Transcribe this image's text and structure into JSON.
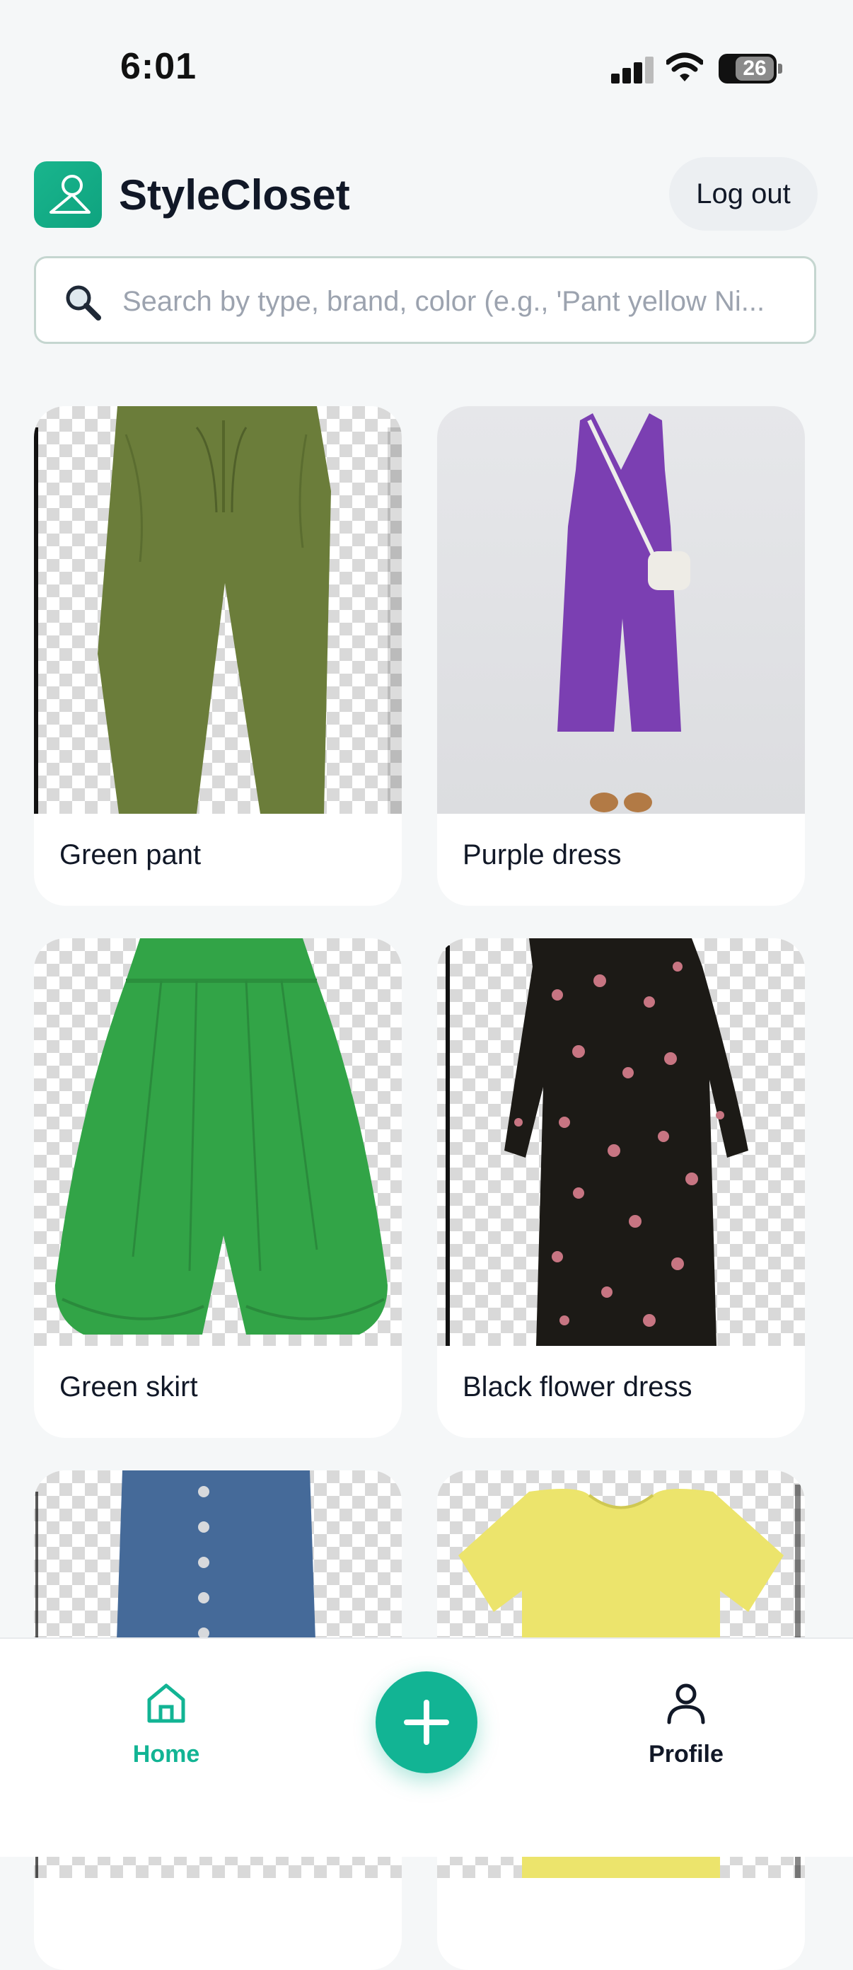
{
  "status_bar": {
    "time": "6:01",
    "battery": "26"
  },
  "header": {
    "app_name": "StyleCloset",
    "logout_label": "Log out"
  },
  "search": {
    "placeholder": "Search by type, brand, color (e.g., 'Pant yellow Ni...",
    "value": ""
  },
  "items": [
    {
      "label": "Green pant",
      "color": "#6b7d3a"
    },
    {
      "label": "Purple dress",
      "color": "#7b3fb2"
    },
    {
      "label": "Green skirt",
      "color": "#32a447"
    },
    {
      "label": "Black flower dress",
      "color": "#1c1a16"
    },
    {
      "label": "",
      "color": "#456a99"
    },
    {
      "label": "",
      "color": "#ece46c"
    }
  ],
  "bottom_nav": {
    "home_label": "Home",
    "profile_label": "Profile",
    "active": "Home",
    "accent": "#12b494"
  },
  "icons": [
    "hanger-user-logo",
    "search-icon",
    "home-icon",
    "plus-icon",
    "profile-icon"
  ]
}
